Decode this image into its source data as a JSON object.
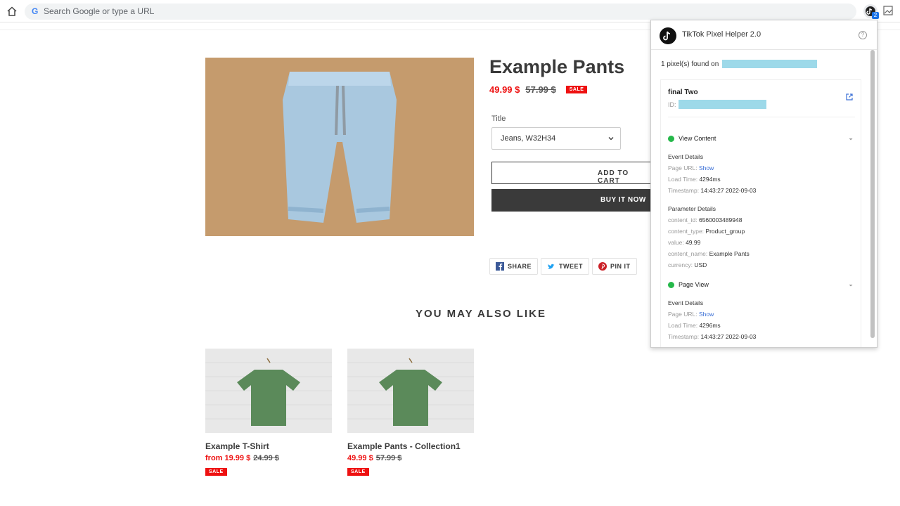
{
  "browser": {
    "omnibox_placeholder": "Search Google or type a URL",
    "ext_badge": "2"
  },
  "product": {
    "title": "Example Pants",
    "price": "49.99 $",
    "compare_price": "57.99 $",
    "sale_badge": "SALE",
    "variant_label": "Title",
    "variant_value": "Jeans, W32H34",
    "add_to_cart": "ADD TO CART",
    "buy_now": "BUY IT NOW",
    "share": {
      "facebook": "SHARE",
      "twitter": "TWEET",
      "pinterest": "PIN IT"
    }
  },
  "related": {
    "heading": "YOU MAY ALSO LIKE",
    "items": [
      {
        "title": "Example T-Shirt",
        "price": "from 19.99 $",
        "compare_price": "24.99 $",
        "badge": "SALE"
      },
      {
        "title": "Example Pants - Collection1",
        "price": "49.99 $",
        "compare_price": "57.99 $",
        "badge": "SALE"
      }
    ]
  },
  "popup": {
    "title": "TikTok Pixel Helper 2.0",
    "help": "?",
    "found_text": "1 pixel(s) found on",
    "pixel_name": "final Two",
    "id_label": "ID:",
    "events": [
      {
        "name": "View Content",
        "event_details_label": "Event Details",
        "page_url_label": "Page URL:",
        "page_url_value": "Show",
        "load_time_label": "Load Time:",
        "load_time_value": "4294ms",
        "timestamp_label": "Timestamp:",
        "timestamp_value": "14:43:27 2022-09-03",
        "parameter_details_label": "Parameter Details",
        "params": [
          {
            "key": "content_id:",
            "value": "6560003489948"
          },
          {
            "key": "content_type:",
            "value": "Product_group"
          },
          {
            "key": "value:",
            "value": "49.99"
          },
          {
            "key": "content_name:",
            "value": "Example Pants"
          },
          {
            "key": "currency:",
            "value": "USD"
          }
        ]
      },
      {
        "name": "Page View",
        "event_details_label": "Event Details",
        "page_url_label": "Page URL:",
        "page_url_value": "Show",
        "load_time_label": "Load Time:",
        "load_time_value": "4296ms",
        "timestamp_label": "Timestamp:",
        "timestamp_value": "14:43:27 2022-09-03"
      }
    ]
  },
  "colors": {
    "sale_red": "#ee1111",
    "button_dark": "#3a3a3a",
    "link_blue": "#3a6fd6",
    "check_green": "#25b84a",
    "redaction": "#9dd9e9"
  },
  "icons": {
    "home": "home-icon",
    "google": "google-g-icon",
    "tiktok_ext": "tiktok-extension-icon",
    "other_ext": "image-extension-icon",
    "facebook": "facebook-icon",
    "twitter": "twitter-icon",
    "pinterest": "pinterest-icon",
    "open": "open-external-icon",
    "check": "check-circle-icon",
    "chevron": "chevron-down-icon"
  }
}
